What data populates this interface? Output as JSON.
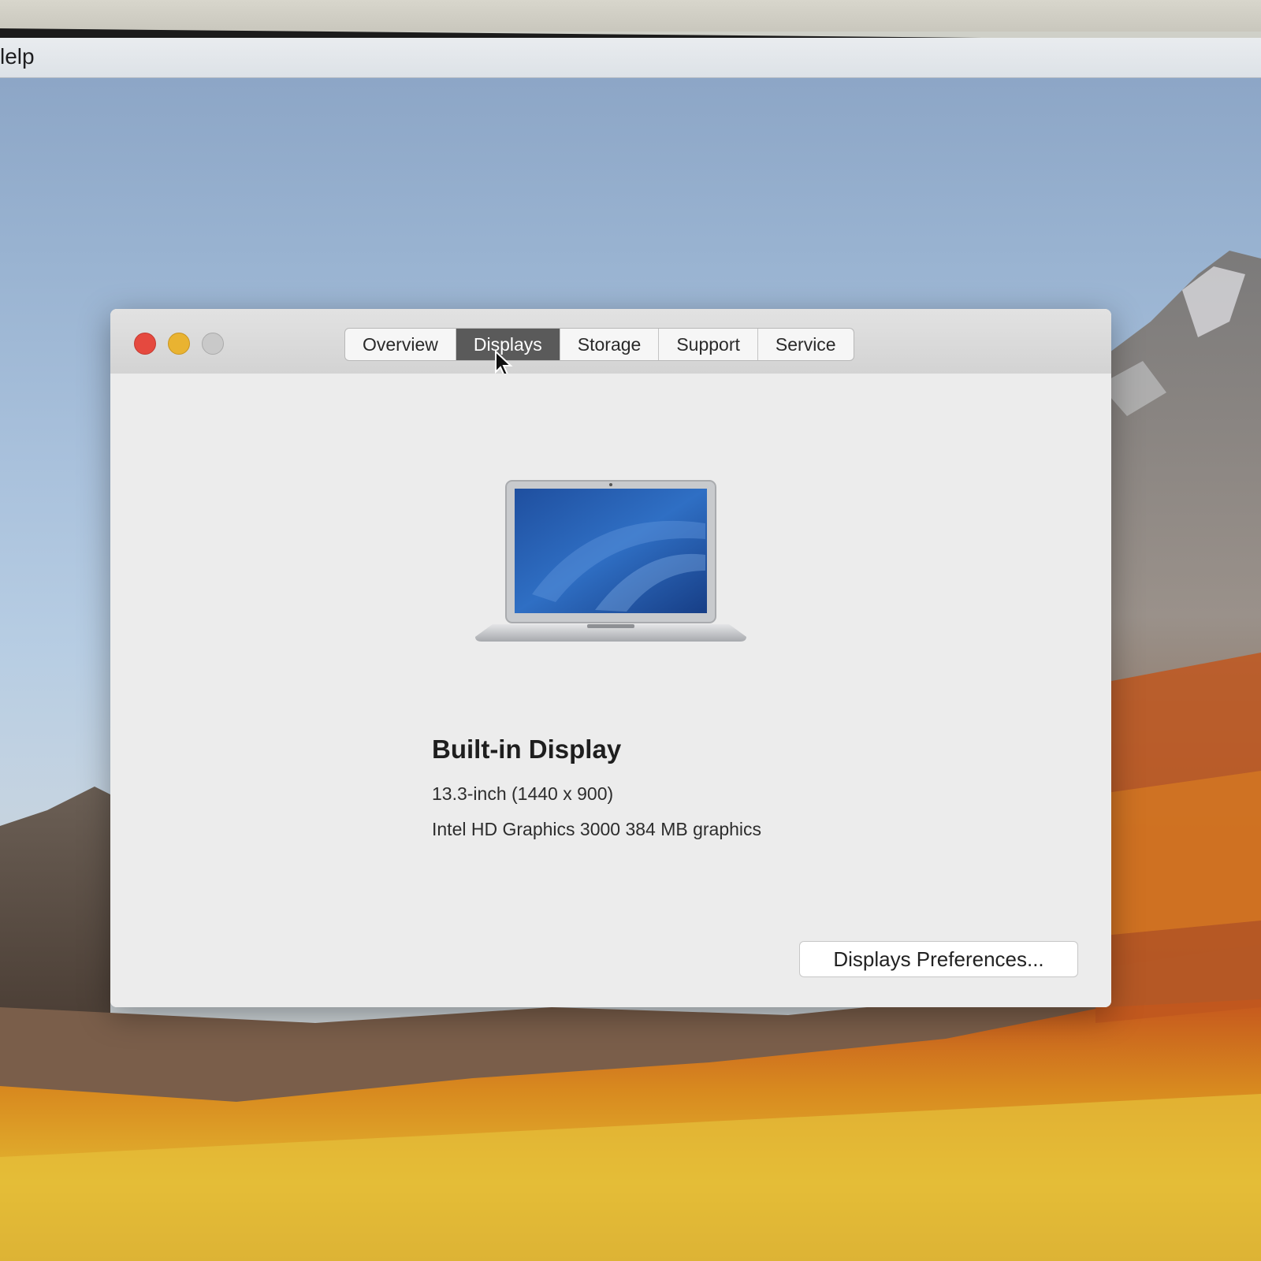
{
  "menubar": {
    "partial_menu": "lelp"
  },
  "window": {
    "tabs": [
      {
        "label": "Overview"
      },
      {
        "label": "Displays"
      },
      {
        "label": "Storage"
      },
      {
        "label": "Support"
      },
      {
        "label": "Service"
      }
    ],
    "active_tab": "Displays",
    "display": {
      "title": "Built-in Display",
      "size": "13.3-inch (1440 x 900)",
      "graphics": "Intel HD Graphics 3000 384 MB graphics"
    },
    "prefs_button": "Displays Preferences..."
  },
  "colors": {
    "close": "#e5493f",
    "minimize": "#e9b331",
    "zoom": "#c9c9c9",
    "active_tab": "#5a5a5a"
  },
  "icons": [
    "close-icon",
    "minimize-icon",
    "zoom-icon",
    "pointer-cursor-icon",
    "laptop-icon"
  ]
}
